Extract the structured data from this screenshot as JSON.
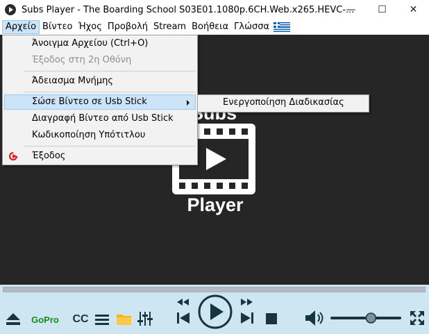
{
  "window": {
    "title": "Subs Player - The Boarding School S03E01.1080p.6CH.Web.x265.HEVC-...",
    "minimize": "—",
    "maximize": "☐",
    "close": "✕"
  },
  "menubar": {
    "items": [
      "Αρχείο",
      "Βίντεο",
      "Ήχος",
      "Προβολή",
      "Stream",
      "Βοήθεια",
      "Γλώσσα"
    ]
  },
  "file_menu": {
    "items": [
      {
        "label": "Άνοιγμα Αρχείου (Ctrl+O)"
      },
      {
        "label": "Έξοδος στη 2η Οθόνη"
      },
      {
        "label": "Άδειασμα Μνήμης"
      },
      {
        "label": "Σώσε Βίντεο σε Usb Stick"
      },
      {
        "label": "Διαγραφή Βίντεο από Usb Stick"
      },
      {
        "label": "Κωδικοποίηση Υπότιτλου"
      },
      {
        "label": "Έξοδος"
      }
    ]
  },
  "submenu": {
    "items": [
      {
        "label": "Ενεργοποίηση Διαδικασίας"
      }
    ]
  },
  "logo": {
    "top": "Subs",
    "bottom": "Player"
  },
  "controls": {
    "gopro_label": "GoPro",
    "cc_label": "CC",
    "volume": 0.58
  },
  "colors": {
    "accent_green": "#1a8a1a",
    "highlight": "#cce4f7",
    "control_bg": "#cde6f2",
    "video_bg": "#262626"
  }
}
